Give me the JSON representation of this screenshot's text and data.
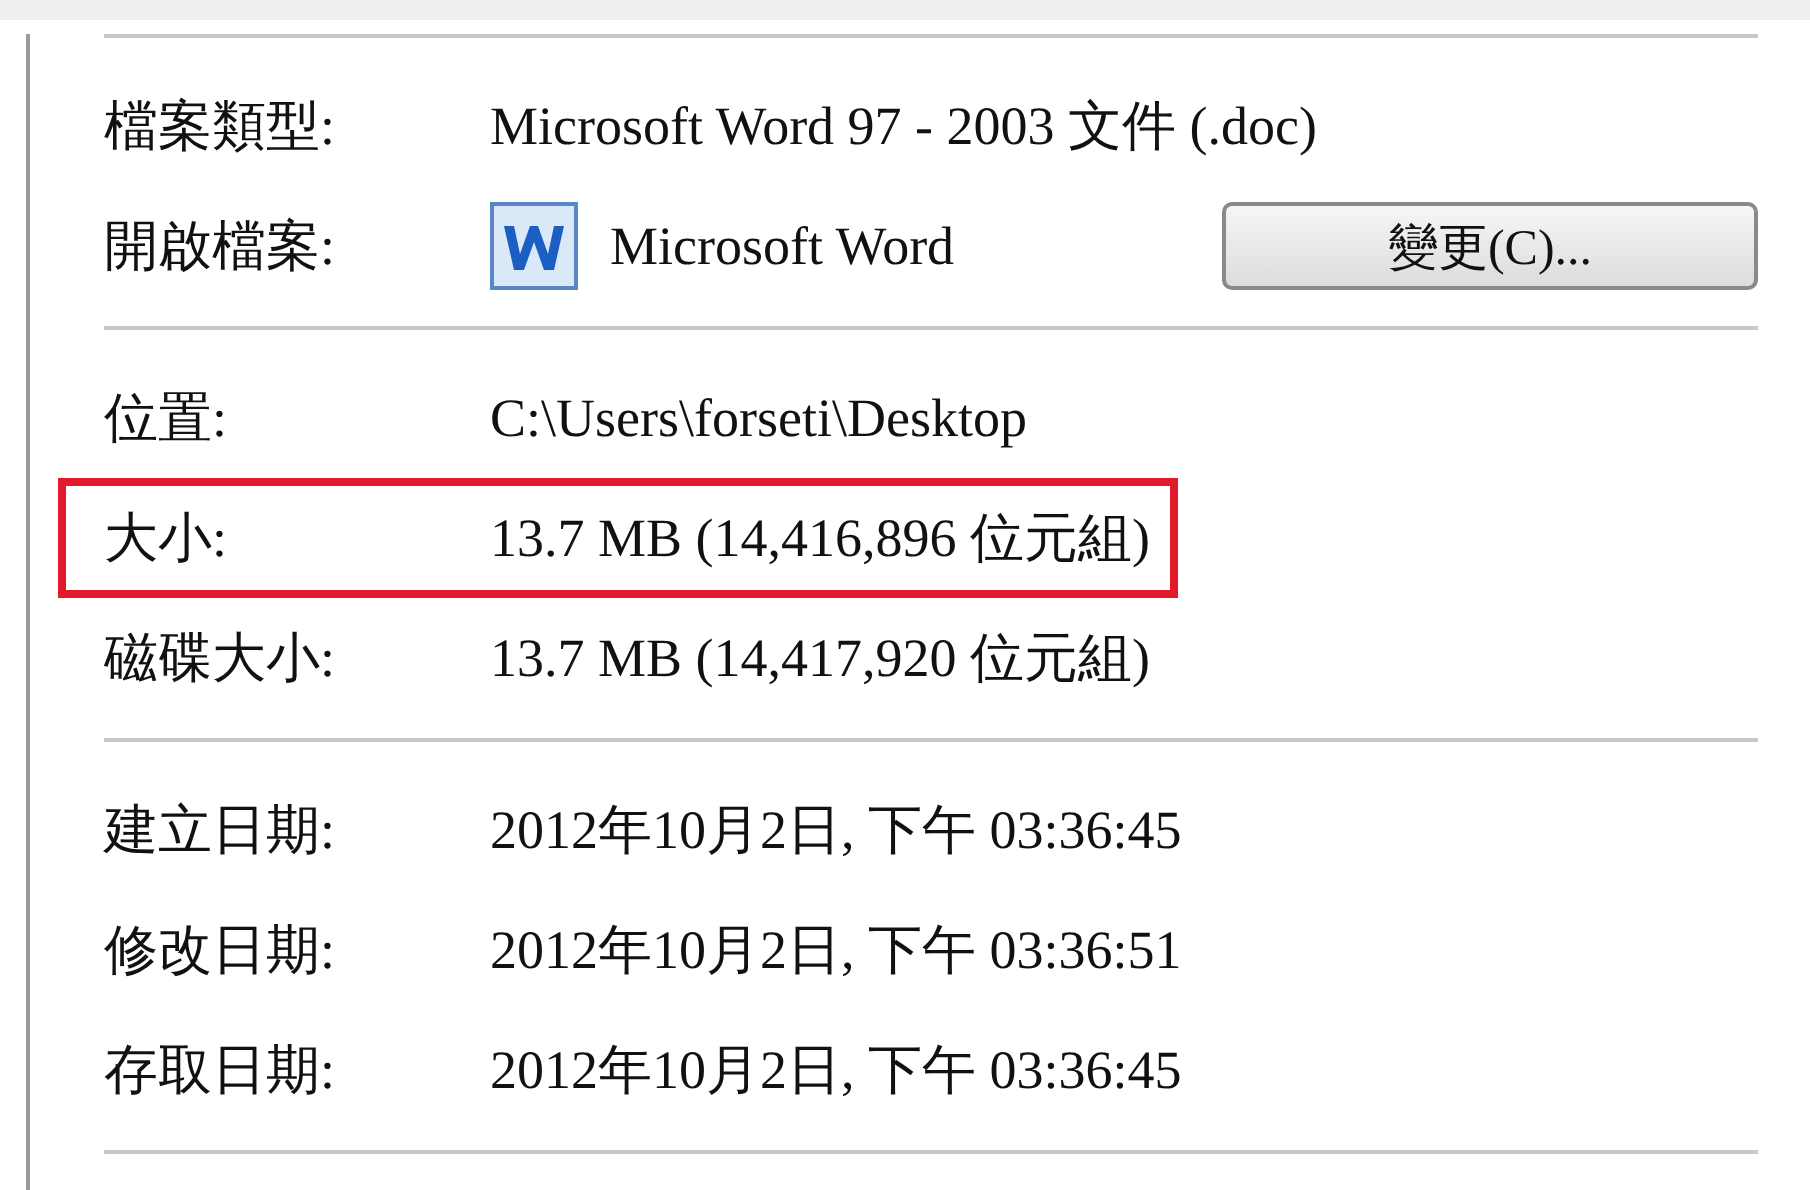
{
  "sections": [
    {
      "rows": [
        {
          "kind": "text",
          "label": "檔案類型:",
          "value": "Microsoft Word 97 - 2003 文件 (.doc)",
          "highlighted": false
        },
        {
          "kind": "app",
          "label": "開啟檔案:",
          "value": "Microsoft Word",
          "button": "變更(C)...",
          "highlighted": false
        }
      ]
    },
    {
      "rows": [
        {
          "kind": "text",
          "label": "位置:",
          "value": "C:\\Users\\forseti\\Desktop",
          "highlighted": false
        },
        {
          "kind": "text",
          "label": "大小:",
          "value": "13.7 MB (14,416,896 位元組)",
          "highlighted": true
        },
        {
          "kind": "text",
          "label": "磁碟大小:",
          "value": "13.7 MB (14,417,920 位元組)",
          "highlighted": false
        }
      ]
    },
    {
      "rows": [
        {
          "kind": "text",
          "label": "建立日期:",
          "value": "2012年10月2日, 下午 03:36:45",
          "highlighted": false
        },
        {
          "kind": "text",
          "label": "修改日期:",
          "value": "2012年10月2日, 下午 03:36:51",
          "highlighted": false
        },
        {
          "kind": "text",
          "label": "存取日期:",
          "value": "2012年10月2日, 下午 03:36:45",
          "highlighted": false
        }
      ]
    }
  ]
}
